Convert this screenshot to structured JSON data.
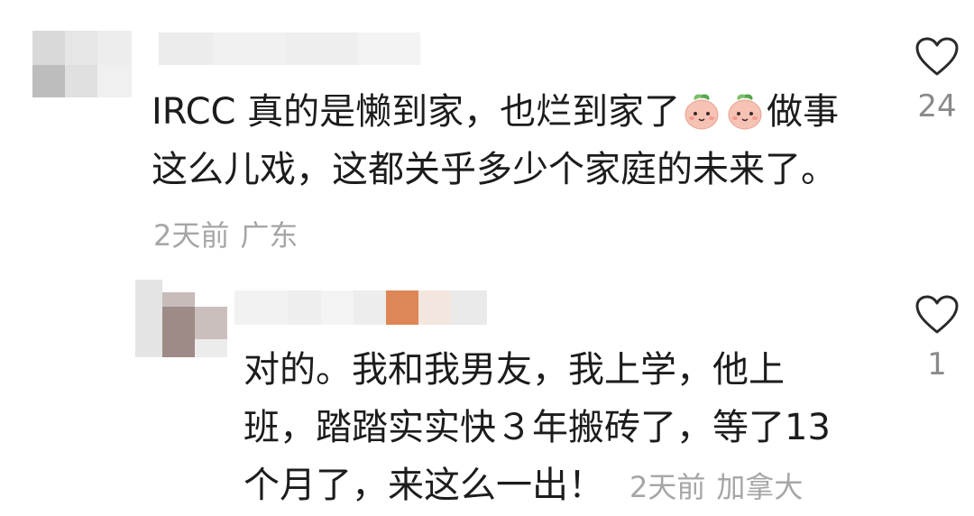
{
  "comments": [
    {
      "text_line1": "IRCC 真的是懒到家，也烂到家了",
      "text_after_emoji": "做事",
      "text_line2": "这么儿戏，这都关乎多少个家庭的未来了。",
      "emoji_icon": "peach-face-emoji",
      "time": "2天前",
      "location": "广东",
      "likes": "24"
    },
    {
      "text_line1": "对的。我和我男友，我上学，他上",
      "text_line2": "班，踏踏实实快３年搬砖了，等了13",
      "text_line3": "个月了，来这么一出！",
      "time": "2天前",
      "location": "加拿大",
      "likes": "1"
    }
  ],
  "colors": {
    "text": "#1c1c1c",
    "meta": "#a6a6a6",
    "heart": "#2a2a2a"
  }
}
